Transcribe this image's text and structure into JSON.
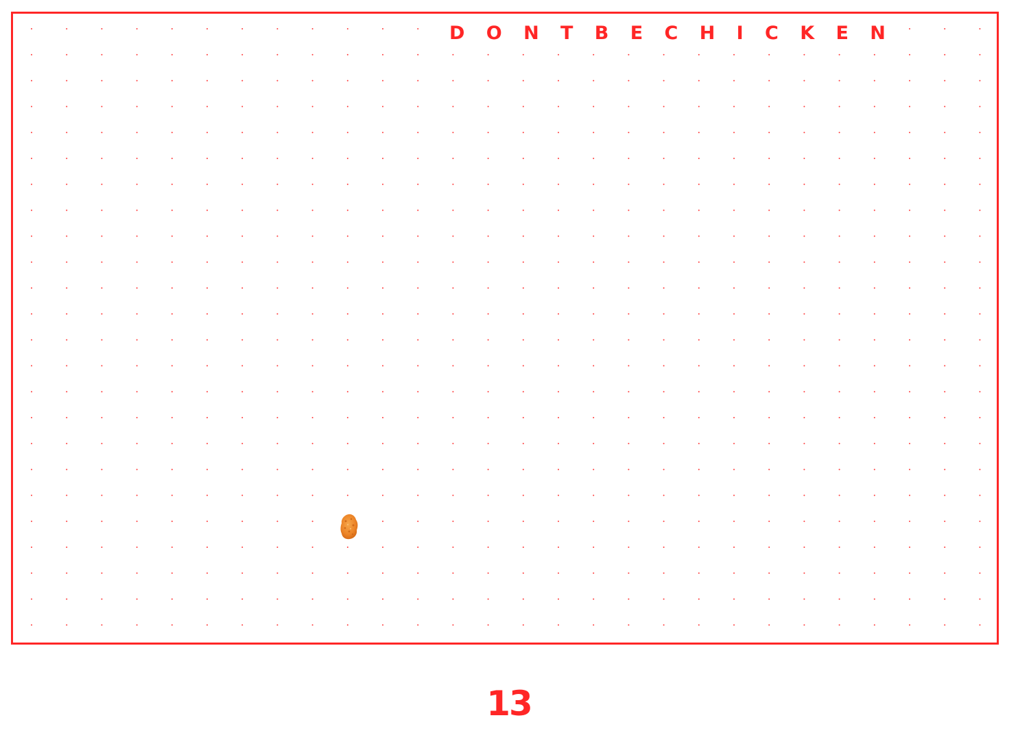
{
  "game": {
    "title_letters": [
      "D",
      "O",
      "N",
      "T",
      "B",
      "E",
      "C",
      "H",
      "I",
      "C",
      "K",
      "E",
      "N"
    ],
    "score": "13",
    "player_icon": "chicken-nugget-icon"
  },
  "colors": {
    "accent": "#ff2626",
    "dot": "#ff3a3a",
    "nugget": "#f08a2c",
    "background": "#ffffff"
  }
}
